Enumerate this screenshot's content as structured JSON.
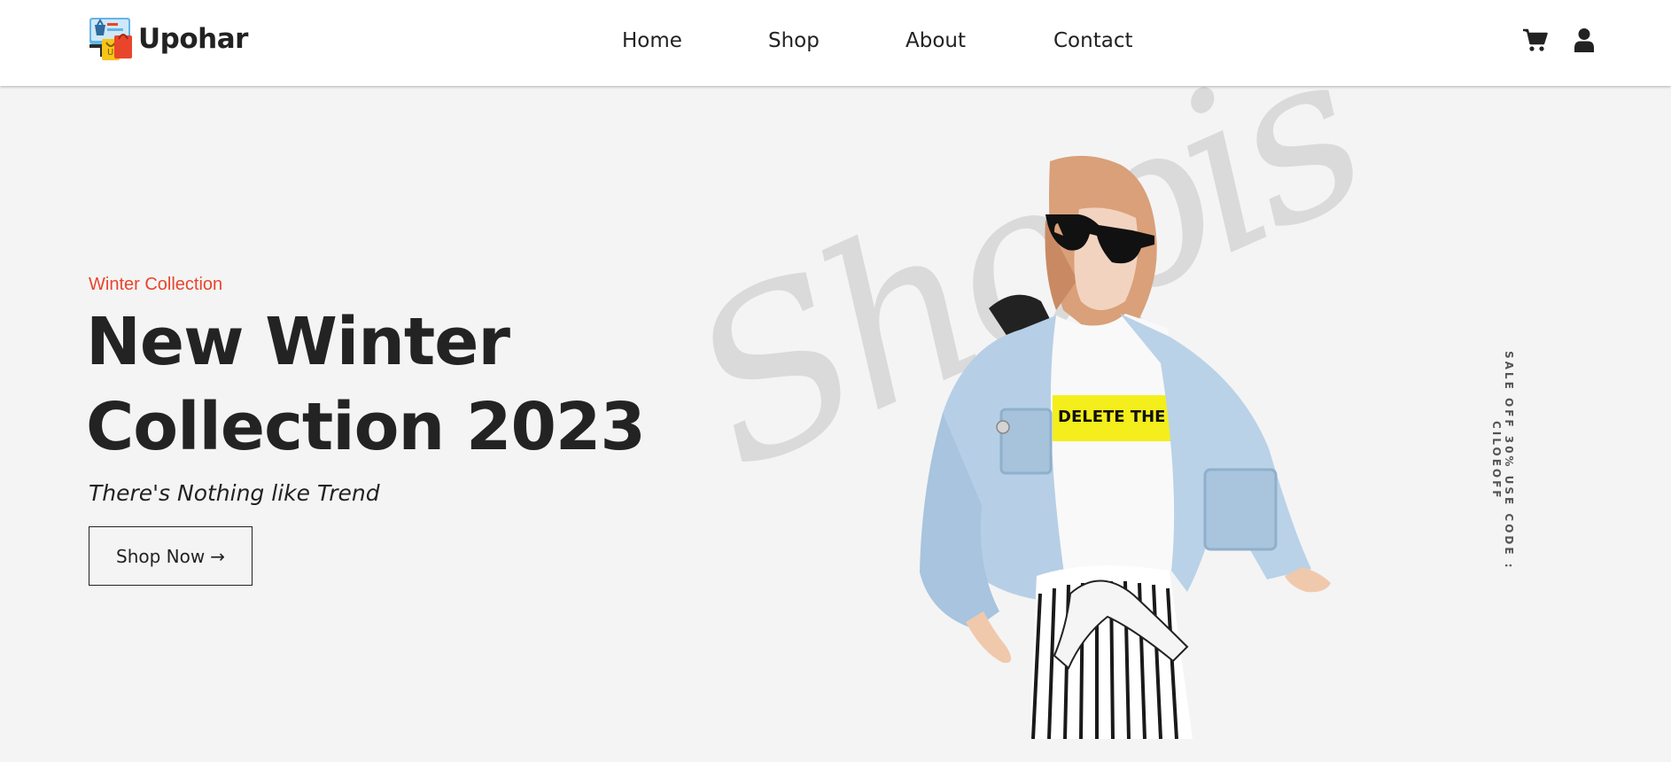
{
  "brand": {
    "name": "Upohar"
  },
  "nav": {
    "links": [
      {
        "label": "Home"
      },
      {
        "label": "Shop"
      },
      {
        "label": "About"
      },
      {
        "label": "Contact"
      }
    ],
    "icons": [
      "cart-icon",
      "user-icon"
    ]
  },
  "hero": {
    "eyebrow": "Winter Collection",
    "title_line1": "New Winter",
    "title_line2": "Collection 2023",
    "subtitle": "There's Nothing like Trend",
    "cta_label": "Shop Now",
    "cta_icon": "arrow-right-icon",
    "watermark": "Shopis",
    "tshirt_print": "DELETE THE DRAMA",
    "sale_text": "SALE OFF 30% USE CODE : CILOEOFF"
  },
  "colors": {
    "accent": "#e8452c",
    "text": "#222222",
    "background": "#f4f4f4",
    "navbar": "#ffffff"
  }
}
